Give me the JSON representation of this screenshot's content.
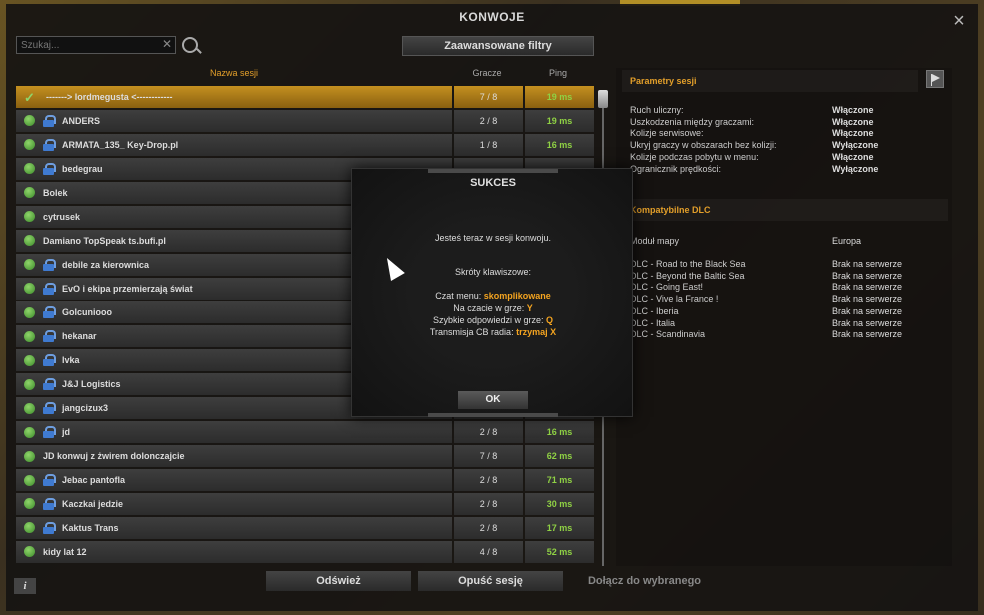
{
  "window": {
    "title": "KONWOJE",
    "close_label": "×"
  },
  "search": {
    "placeholder": "Szukaj...",
    "value": "Szukaj...",
    "clear": "✕"
  },
  "filters_label": "Zaawansowane filtry",
  "columns": {
    "name": "Nazwa sesji",
    "players": "Gracze",
    "ping": "Ping"
  },
  "sessions": [
    {
      "name": "-------> lordmegusta <------------",
      "players": "7 / 8",
      "ping": "19 ms",
      "locked": false,
      "selected": true
    },
    {
      "name": "ANDERS",
      "players": "2 / 8",
      "ping": "19 ms",
      "locked": true
    },
    {
      "name": "ARMATA_135_ Key-Drop.pl",
      "players": "1 / 8",
      "ping": "16 ms",
      "locked": true
    },
    {
      "name": "bedegrau",
      "players": "",
      "ping": "",
      "locked": true
    },
    {
      "name": "Bolek",
      "players": "",
      "ping": "",
      "locked": false
    },
    {
      "name": "cytrusek",
      "players": "",
      "ping": "",
      "locked": false
    },
    {
      "name": "Damiano TopSpeak ts.bufi.pl",
      "players": "",
      "ping": "",
      "locked": false
    },
    {
      "name": "debile za kierownica",
      "players": "",
      "ping": "",
      "locked": true
    },
    {
      "name": "EvO i ekipa przemierzają świat",
      "players": "",
      "ping": "",
      "locked": true
    },
    {
      "name": "Golcuniooo",
      "players": "",
      "ping": "",
      "locked": true
    },
    {
      "name": "hekanar",
      "players": "",
      "ping": "",
      "locked": true
    },
    {
      "name": "lvka",
      "players": "",
      "ping": "",
      "locked": true
    },
    {
      "name": "J&J Logistics",
      "players": "",
      "ping": "",
      "locked": true
    },
    {
      "name": "jangcizux3",
      "players": "",
      "ping": "",
      "locked": true
    },
    {
      "name": "jd",
      "players": "2 / 8",
      "ping": "16 ms",
      "locked": true
    },
    {
      "name": "JD konwuj z żwirem dolonczajcie",
      "players": "7 / 8",
      "ping": "62 ms",
      "locked": false
    },
    {
      "name": "Jebac pantofla",
      "players": "2 / 8",
      "ping": "71 ms",
      "locked": true
    },
    {
      "name": "Kaczkai jedzie",
      "players": "2 / 8",
      "ping": "30 ms",
      "locked": true
    },
    {
      "name": "Kaktus Trans",
      "players": "2 / 8",
      "ping": "17 ms",
      "locked": true
    },
    {
      "name": "kidy lat 12",
      "players": "4 / 8",
      "ping": "52 ms",
      "locked": false
    }
  ],
  "params": {
    "header": "Parametry sesji",
    "rows": [
      {
        "k": "Ruch uliczny:",
        "v": "Włączone"
      },
      {
        "k": "Uszkodzenia między graczami:",
        "v": "Włączone"
      },
      {
        "k": "Kolizje serwisowe:",
        "v": "Włączone"
      },
      {
        "k": "Ukryj graczy w obszarach bez kolizji:",
        "v": "Wyłączone"
      },
      {
        "k": "Kolizje podczas pobytu w menu:",
        "v": "Włączone"
      },
      {
        "k": "Ogranicznik prędkości:",
        "v": "Wyłączone"
      }
    ]
  },
  "dlc": {
    "header": "Kompatybilne DLC",
    "col_module": "Moduł mapy",
    "col_value": "Europa",
    "rows": [
      {
        "k": "DLC - Road to the Black Sea",
        "v": "Brak na serwerze"
      },
      {
        "k": "DLC - Beyond the Baltic Sea",
        "v": "Brak na serwerze"
      },
      {
        "k": "DLC - Going East!",
        "v": "Brak na serwerze"
      },
      {
        "k": "DLC - Vive la France !",
        "v": "Brak na serwerze"
      },
      {
        "k": "DLC - Iberia",
        "v": "Brak na serwerze"
      },
      {
        "k": "DLC - Italia",
        "v": "Brak na serwerze"
      },
      {
        "k": "DLC - Scandinavia",
        "v": "Brak na serwerze"
      }
    ]
  },
  "buttons": {
    "refresh": "Odśwież",
    "leave": "Opuść sesję",
    "join": "Dołącz do wybranego",
    "info": "i"
  },
  "modal": {
    "title": "SUKCES",
    "message": "Jesteś teraz w sesji konwoju.",
    "shortcuts_title": "Skróty klawiszowe:",
    "lines": [
      {
        "label": "Czat menu: ",
        "key": "skomplikowane"
      },
      {
        "label": "Na czacie w grze: ",
        "key": "Y"
      },
      {
        "label": "Szybkie odpowiedzi w grze: ",
        "key": "Q"
      },
      {
        "label": "Transmisja CB radia: ",
        "key": "trzymaj X"
      }
    ],
    "ok": "OK"
  },
  "colors": {
    "accent": "#e39f2a",
    "ping_green": "#8fd144",
    "selected_row": "#c49020",
    "lock_blue": "#3f7ad0"
  }
}
